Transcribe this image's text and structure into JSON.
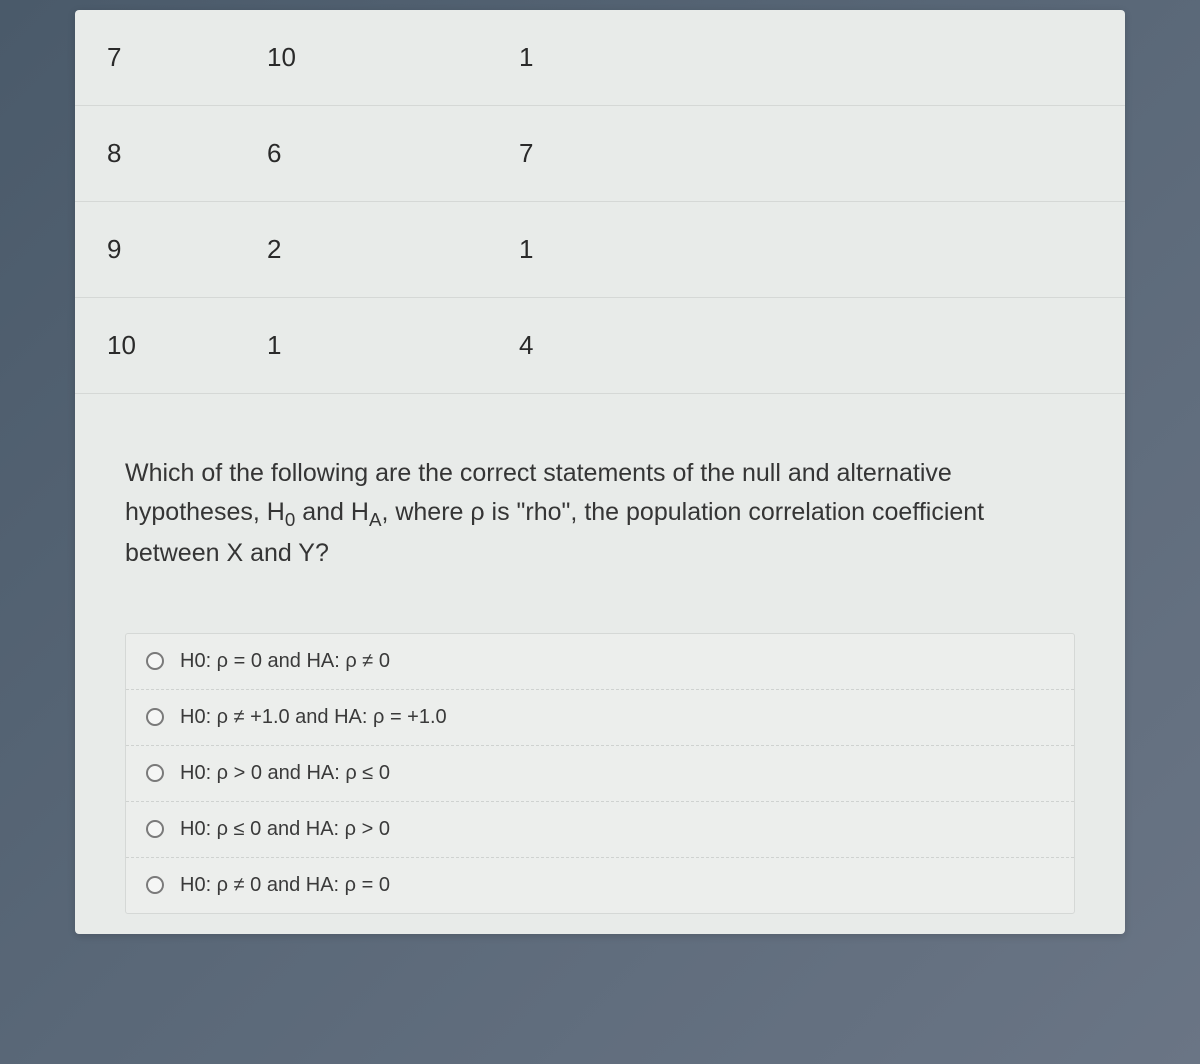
{
  "table": {
    "rows": [
      {
        "c1": "7",
        "c2": "10",
        "c3": "1"
      },
      {
        "c1": "8",
        "c2": "6",
        "c3": "7"
      },
      {
        "c1": "9",
        "c2": "2",
        "c3": "1"
      },
      {
        "c1": "10",
        "c2": "1",
        "c3": "4"
      }
    ]
  },
  "question": {
    "lead": "Which of the following are the correct statements of the null and alternative hypotheses, H",
    "sub0": "0",
    "mid1": " and H",
    "subA": "A",
    "tail": ", where ρ is \"rho\", the population correlation coefficient between X and Y?"
  },
  "options": [
    {
      "label": "H0: ρ = 0 and HA: ρ ≠ 0"
    },
    {
      "label": "H0: ρ ≠ +1.0 and HA: ρ = +1.0"
    },
    {
      "label": "H0: ρ > 0 and HA: ρ ≤ 0"
    },
    {
      "label": "H0: ρ ≤ 0 and HA: ρ > 0"
    },
    {
      "label": "H0: ρ ≠ 0 and HA: ρ = 0"
    }
  ]
}
